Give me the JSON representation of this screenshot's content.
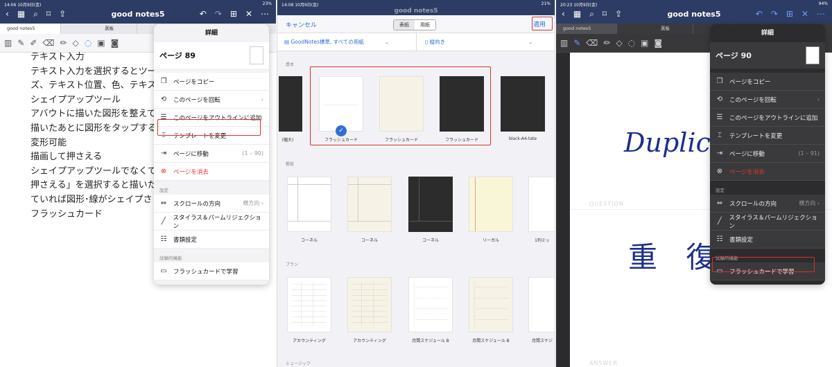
{
  "panel1": {
    "status_time": "14:06",
    "status_date": "10月9日(金)",
    "status_battery": "23%",
    "title": "good notes5",
    "tabs": [
      "good notes5",
      "黒板",
      ""
    ],
    "doc_lines": [
      "テキスト入力",
      "テキスト入力を選択するとツー",
      "ズ、テキスト位置、色、テキス",
      "シェイプアップツール",
      "アバウトに描いた図形を整えて",
      "描いたあとに図形をタップする",
      "変形可能",
      "描画して押さえる",
      "シェイプアップツールでなくて",
      "押さえる」を選択すると描いた",
      "ていれば図形･線がシェイプさ",
      "フラッシュカード"
    ],
    "popover": {
      "header": "詳細",
      "page_label": "ページ 89",
      "items": [
        {
          "label": "ページをコピー",
          "right": ""
        },
        {
          "label": "このページを回転",
          "right": "›"
        },
        {
          "label": "このページをアウトラインに追加",
          "right": ""
        },
        {
          "label": "テンプレートを変更",
          "right": ""
        },
        {
          "label": "ページに移動",
          "right": "(1 – 90)"
        },
        {
          "label": "ページを消去",
          "right": ""
        }
      ],
      "settings_header": "設定",
      "settings_items": [
        {
          "label": "スクロールの方向",
          "right": "横方向 ›"
        },
        {
          "label": "スタイラス＆パームリジェクション",
          "right": ""
        },
        {
          "label": "書類設定",
          "right": ""
        }
      ],
      "lab_header": "試験的機能",
      "lab_item": "フラッシュカードで学習"
    }
  },
  "panel2": {
    "status_time": "14:08",
    "status_date": "10月9日(金)",
    "status_battery": "21%",
    "title": "good notes5",
    "cancel": "キャンセル",
    "seg_cover": "表紙",
    "seg_paper": "用紙",
    "apply": "適用",
    "filter": "GoodNotes標準, すべての用紙",
    "orientation": "縦向き",
    "cat_basic": "基本",
    "basic_templates": [
      "(幅大)",
      "フラッシュカード",
      "フラッシュカード",
      "フラッシュカード",
      "black-A4-tate"
    ],
    "cat_ruled": "罫紙",
    "ruled_templates": [
      "コーネル",
      "コーネル",
      "コーネル",
      "リーガル",
      "1列ミッ"
    ],
    "cat_plan": "プラン",
    "plan_templates": [
      "アカウンティング",
      "アカウンティング",
      "月間スケジュール B",
      "月間スケジュール B",
      "月間スケジ"
    ],
    "cat_music": "ミュージック"
  },
  "panel3": {
    "status_time": "20:23",
    "status_date": "10月9日(金)",
    "status_battery": "94%",
    "title": "good notes5",
    "tabs": [
      "good notes5",
      "黒板",
      ""
    ],
    "hand_en": "Duplica",
    "hand_jp": "重 復",
    "question_label": "QUESTION",
    "answer_label": "ANSWER",
    "popover": {
      "header": "詳細",
      "page_label": "ページ 90",
      "items": [
        {
          "label": "ページをコピー",
          "right": ""
        },
        {
          "label": "このページを回転",
          "right": "›"
        },
        {
          "label": "このページをアウトラインに追加",
          "right": ""
        },
        {
          "label": "テンプレートを変更",
          "right": ""
        },
        {
          "label": "ページに移動",
          "right": "(1 – 91)"
        },
        {
          "label": "ページを消去",
          "right": ""
        }
      ],
      "settings_header": "設定",
      "settings_items": [
        {
          "label": "スクロールの方向",
          "right": "横方向 ›"
        },
        {
          "label": "スタイラス＆パームリジェクション",
          "right": ""
        },
        {
          "label": "書類設定",
          "right": ""
        }
      ],
      "lab_header": "試験的機能",
      "lab_item": "フラッシュカードで学習"
    }
  },
  "colors": {
    "nav": "#2d3c64",
    "accent": "#2f6fd6",
    "highlight": "#d9302a",
    "danger": "#e0362e"
  }
}
